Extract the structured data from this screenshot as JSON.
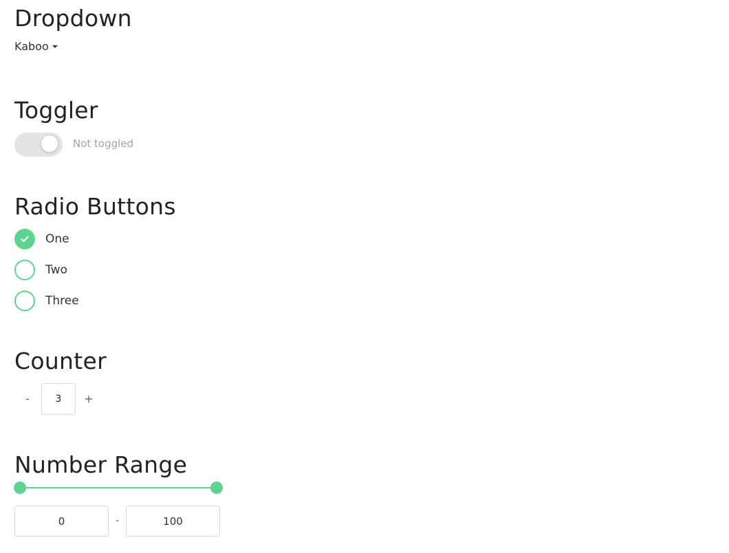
{
  "sections": {
    "dropdown": {
      "heading": "Dropdown",
      "selected": "Kaboo"
    },
    "toggler": {
      "heading": "Toggler",
      "status_label": "Not toggled",
      "toggled": false
    },
    "radio": {
      "heading": "Radio Buttons",
      "options": [
        {
          "label": "One",
          "checked": true
        },
        {
          "label": "Two",
          "checked": false
        },
        {
          "label": "Three",
          "checked": false
        }
      ]
    },
    "counter": {
      "heading": "Counter",
      "decrement_label": "-",
      "value": "3",
      "increment_label": "+"
    },
    "range": {
      "heading": "Number Range",
      "min": "0",
      "separator": "-",
      "max": "100",
      "range_min": 0,
      "range_max": 100
    }
  },
  "colors": {
    "accent": "#5dd48e",
    "toggle_track": "#e3e3e3",
    "muted_text": "#a3a3a3"
  }
}
